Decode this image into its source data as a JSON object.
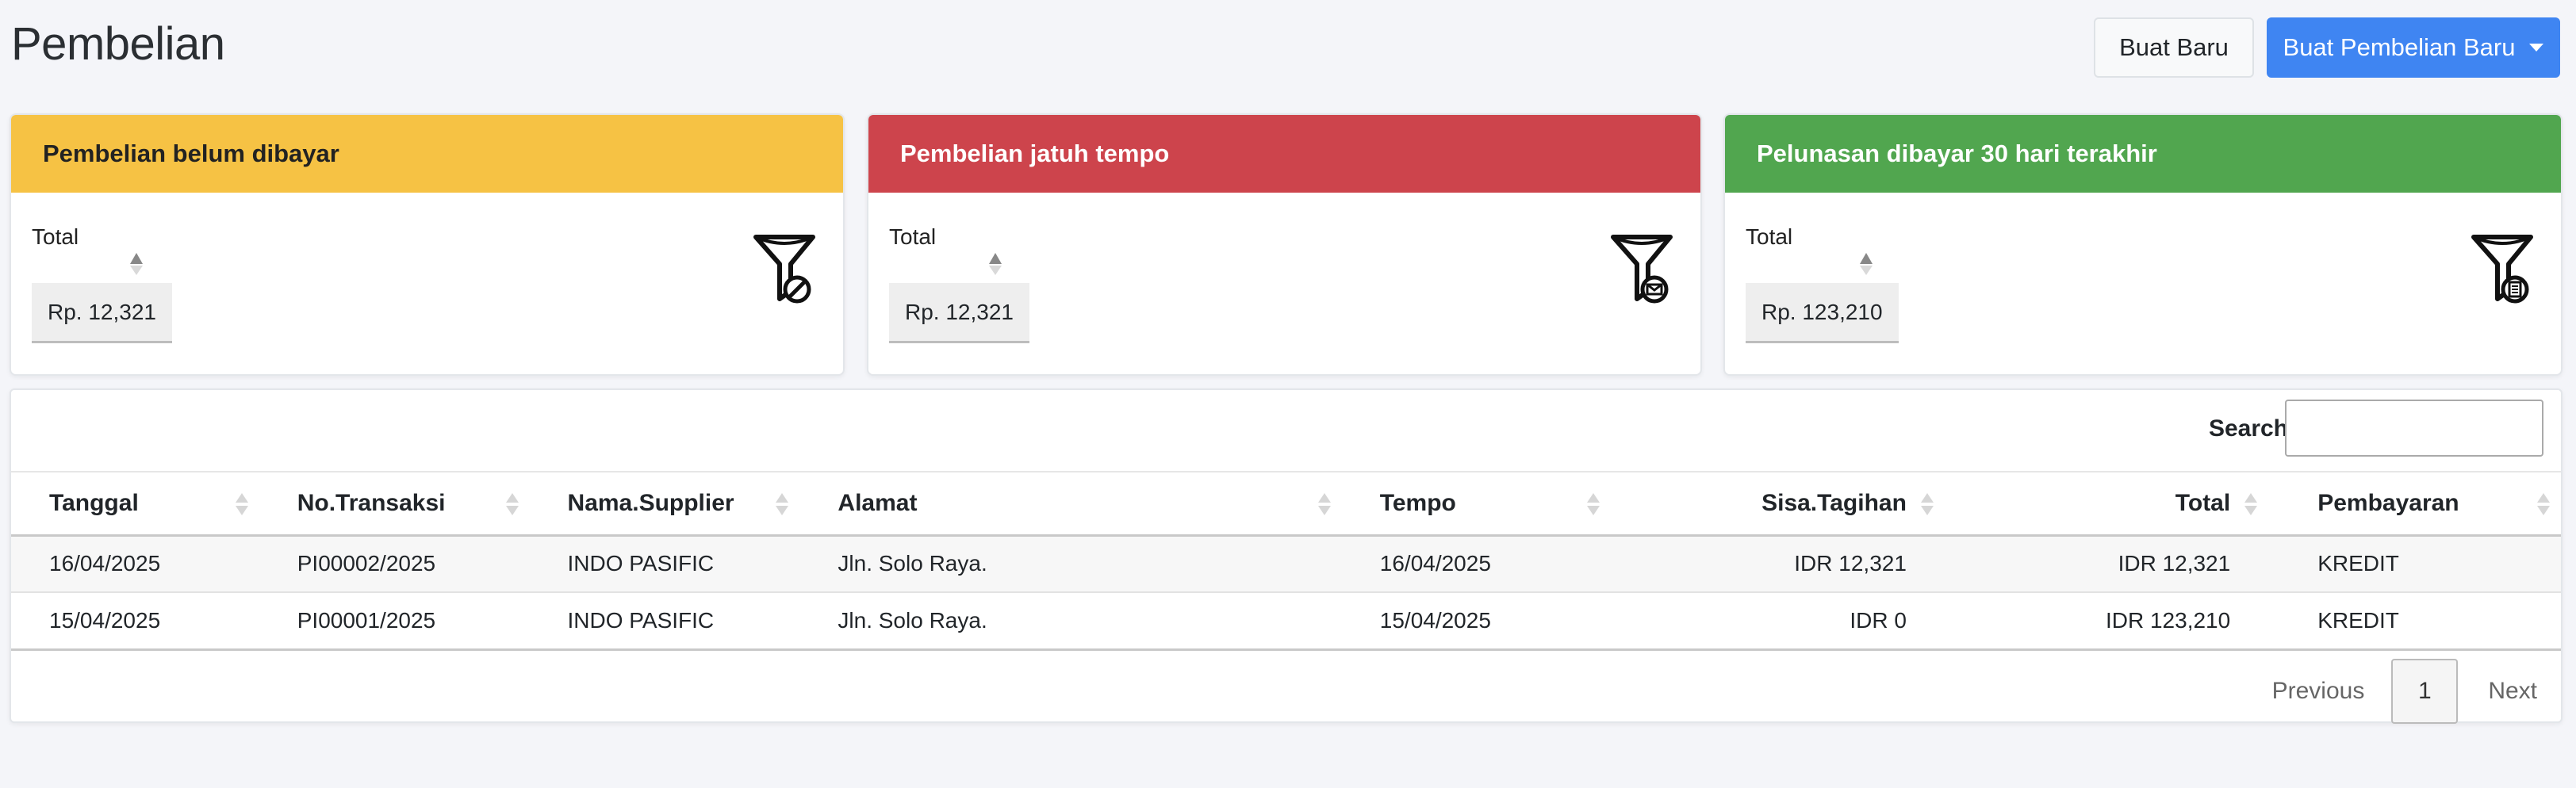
{
  "page": {
    "title": "Pembelian"
  },
  "header_buttons": {
    "new_label": "Buat Baru",
    "new_purchase_label": "Buat Pembelian Baru"
  },
  "cards": [
    {
      "title": "Pembelian belum dibayar",
      "total_label": "Total",
      "total_value": "Rp. 12,321",
      "color": "#f6c244",
      "icon": "funnel-block-icon"
    },
    {
      "title": "Pembelian jatuh tempo",
      "total_label": "Total",
      "total_value": "Rp. 12,321",
      "color": "#cd444c",
      "icon": "funnel-mail-icon"
    },
    {
      "title": "Pelunasan dibayar 30 hari terakhir",
      "total_label": "Total",
      "total_value": "Rp. 123,210",
      "color": "#51a64f",
      "icon": "funnel-list-icon"
    }
  ],
  "search": {
    "label": "Search:",
    "value": ""
  },
  "table": {
    "columns": [
      "Tanggal",
      "No.Transaksi",
      "Nama.Supplier",
      "Alamat",
      "Tempo",
      "Sisa.Tagihan",
      "Total",
      "Pembayaran"
    ],
    "rows": [
      [
        "16/04/2025",
        "PI00002/2025",
        "INDO PASIFIC",
        "Jln. Solo Raya.",
        "16/04/2025",
        "IDR 12,321",
        "IDR 12,321",
        "KREDIT"
      ],
      [
        "15/04/2025",
        "PI00001/2025",
        "INDO PASIFIC",
        "Jln. Solo Raya.",
        "15/04/2025",
        "IDR 0",
        "IDR 123,210",
        "KREDIT"
      ]
    ]
  },
  "pagination": {
    "previous": "Previous",
    "current": "1",
    "next": "Next"
  },
  "colors": {
    "primary": "#3f85f2",
    "warning": "#f6c244",
    "danger": "#cd444c",
    "success": "#51a64f"
  }
}
